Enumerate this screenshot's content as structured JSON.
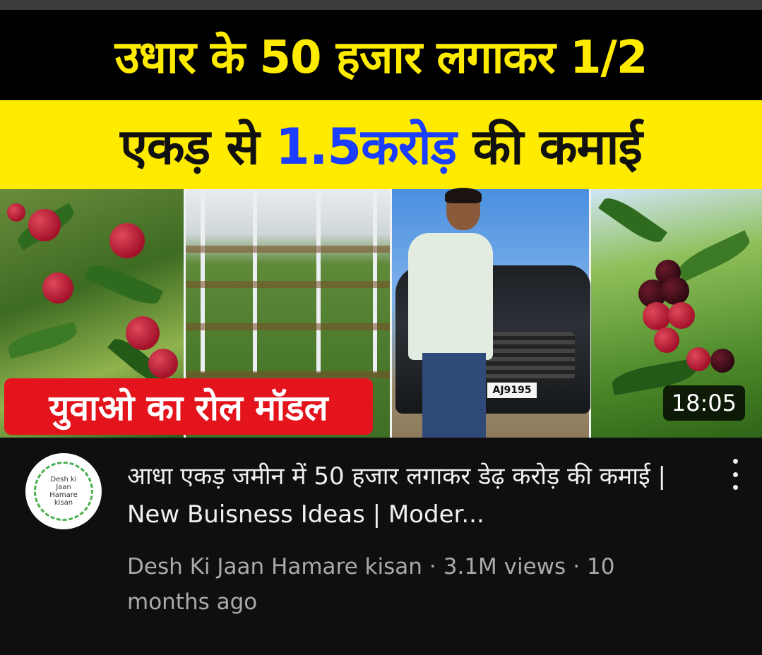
{
  "thumbnail": {
    "headline_line1": "उधार के 50 हजार लगाकर 1/2",
    "headline_line2_part1": "एकड़ से ",
    "headline_line2_part2": "1.5करोड़",
    "headline_line2_part3": " की कमाई",
    "red_label": "युवाओ का रोल मॉडल",
    "plate_text": "AJ9195",
    "duration": "18:05",
    "colors": {
      "headline_yellow": "#ffeb00",
      "highlight_blue": "#1a3dff",
      "label_red": "#e4141c"
    }
  },
  "channel": {
    "avatar_text": "Desh ki Jaan Hamare kisan",
    "name": "Desh Ki Jaan Hamare kisan"
  },
  "video": {
    "title": "आधा एकड़ जमीन में 50 हजार लगाकर डेढ़ करोड़ की कमाई | New Buisness Ideas | Moder...",
    "views": "3.1M views",
    "age": "10 months ago",
    "separator": "·"
  },
  "actions": {
    "menu_icon": "more-vert-icon"
  }
}
